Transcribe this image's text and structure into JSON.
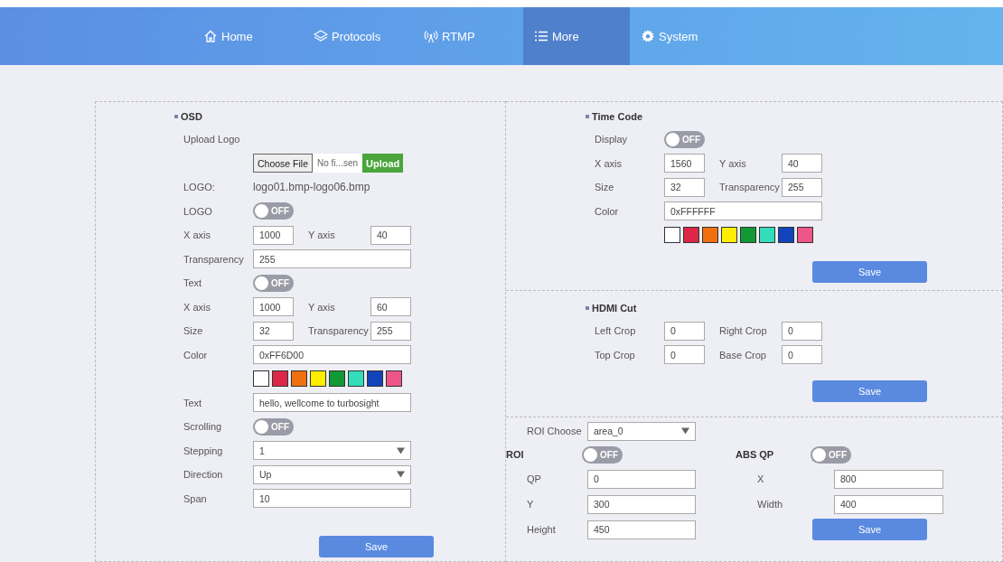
{
  "nav": [
    {
      "label": "Home",
      "selected": false
    },
    {
      "label": "Protocols",
      "selected": false
    },
    {
      "label": "RTMP",
      "selected": false
    },
    {
      "label": "More",
      "selected": true
    },
    {
      "label": "System",
      "selected": false
    }
  ],
  "osd": {
    "title": "OSD",
    "rows": [
      {
        "kind": "text",
        "label": "Upload Logo"
      },
      {
        "kind": "file",
        "choose": "Choose File",
        "file_name": "No fi...sen",
        "upload": "Upload"
      },
      {
        "kind": "info",
        "label": "LOGO:",
        "value": "logo01.bmp-logo06.bmp"
      },
      {
        "kind": "switch",
        "label": "LOGO",
        "on": false,
        "state_text": "OFF"
      },
      {
        "kind": "pair",
        "label": "X axis",
        "value": "1000",
        "label2": "Y axis",
        "value2": "40"
      },
      {
        "kind": "field",
        "label": "Transparency",
        "value": "255"
      },
      {
        "kind": "switch",
        "label": "Text",
        "on": false,
        "state_text": "OFF"
      },
      {
        "kind": "pair",
        "label": "X axis",
        "value": "1000",
        "label2": "Y axis",
        "value2": "60"
      },
      {
        "kind": "pair",
        "label": "Size",
        "value": "32",
        "label2": "Transparency",
        "value2": "255"
      },
      {
        "kind": "field",
        "label": "Color",
        "value": "0xFF6D00"
      },
      {
        "kind": "swatches",
        "swatches": [
          {
            "color": "#ffffff"
          },
          {
            "color": "#dc2747"
          },
          {
            "color": "#f07010"
          },
          {
            "color": "#ffee00"
          },
          {
            "color": "#119933"
          },
          {
            "color": "#33ddbb"
          },
          {
            "color": "#1144bb"
          },
          {
            "color": "#ee5588"
          }
        ]
      },
      {
        "kind": "field",
        "label": "Text",
        "value": "hello, wellcome to turbosight"
      },
      {
        "kind": "switch",
        "label": "Scrolling",
        "on": false,
        "state_text": "OFF"
      },
      {
        "kind": "select",
        "label": "Stepping",
        "value": "1"
      },
      {
        "kind": "select",
        "label": "Direction",
        "value": "Up"
      },
      {
        "kind": "field",
        "label": "Span",
        "value": "10"
      }
    ],
    "save": "Save"
  },
  "time_code": {
    "title": "Time Code",
    "rows": [
      {
        "kind": "switch",
        "label": "Display",
        "on": false,
        "state_text": "OFF"
      },
      {
        "kind": "pair",
        "label": "X axis",
        "value": "1560",
        "label2": "Y axis",
        "value2": "40"
      },
      {
        "kind": "pair",
        "label": "Size",
        "value": "32",
        "label2": "Transparency",
        "value2": "255"
      },
      {
        "kind": "field",
        "label": "Color",
        "value": "0xFFFFFF"
      },
      {
        "kind": "swatches",
        "swatches": [
          {
            "color": "#ffffff"
          },
          {
            "color": "#dc2747"
          },
          {
            "color": "#f07010"
          },
          {
            "color": "#ffee00"
          },
          {
            "color": "#119933"
          },
          {
            "color": "#33ddbb"
          },
          {
            "color": "#1144bb"
          },
          {
            "color": "#ee5588"
          }
        ]
      }
    ],
    "save": "Save"
  },
  "hdmi_cut": {
    "title": "HDMI Cut",
    "rows": [
      {
        "kind": "pair",
        "label": "Left Crop",
        "value": "0",
        "label2": "Right Crop",
        "value2": "0"
      },
      {
        "kind": "pair",
        "label": "Top Crop",
        "value": "0",
        "label2": "Base Crop",
        "value2": "0"
      }
    ],
    "save": "Save"
  },
  "roi": {
    "choose_label": "ROI Choose",
    "choose_value": "area_0",
    "roi_switch": {
      "label": "ROI",
      "on": false,
      "state_text": "OFF"
    },
    "abs_qp_switch": {
      "label": "ABS QP",
      "on": false,
      "state_text": "OFF"
    },
    "left_fields": [
      {
        "label": "QP",
        "value": "0"
      },
      {
        "label": "Y",
        "value": "300"
      },
      {
        "label": "Height",
        "value": "450"
      }
    ],
    "right_fields": [
      {
        "label": "X",
        "value": "800"
      },
      {
        "label": "Width",
        "value": "400"
      }
    ],
    "save": "Save"
  }
}
